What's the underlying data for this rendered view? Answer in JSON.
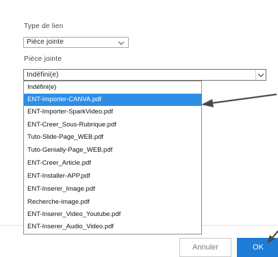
{
  "form": {
    "link_type_label": "Type de lien",
    "link_type_value": "Pièce jointe",
    "attachment_label": "Pièce jointe",
    "attachment_value": "Indéfini(e)"
  },
  "dropdown": {
    "options": [
      "Indéfini(e)",
      "ENT-Importer-CANVA.pdf",
      "ENT-Importer-SparkVideo.pdf",
      "ENT-Creer_Sous-Rubrique.pdf",
      "Tuto-Slide-Page_WEB.pdf",
      "Tuto-Genially-Page_WEB.pdf",
      "ENT-Creer_Article.pdf",
      "ENT-Installer-APP.pdf",
      "ENT-Inserer_Image.pdf",
      "Recherche-image.pdf",
      "ENT-Inserer_Video_Youtube.pdf",
      "ENT-Inserer_Audio_Video.pdf"
    ],
    "highlighted": "ENT-Importer-CANVA.pdf"
  },
  "buttons": {
    "cancel_label": "Annuler",
    "ok_label": "OK"
  },
  "colors": {
    "highlight": "#2e8ee6",
    "ok_button": "#1e7bd6",
    "arrow": "#4a4a4a"
  },
  "icons": {
    "select_chevron": "chevron-down-icon",
    "pointer_arrow": "arrow-annotation-icon"
  }
}
